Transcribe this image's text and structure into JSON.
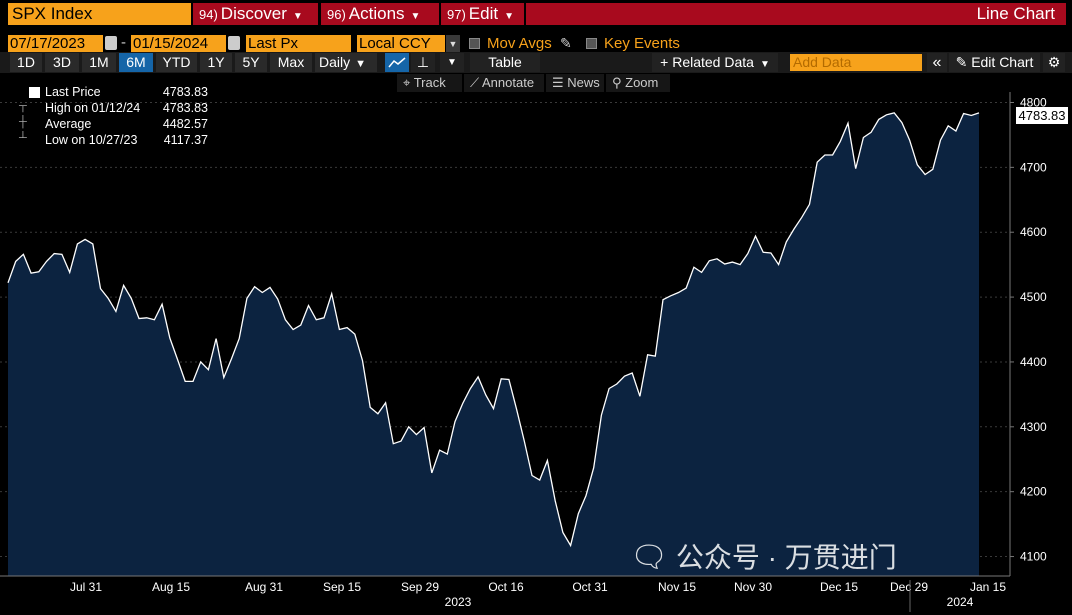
{
  "header": {
    "ticker": "SPX Index",
    "menus": [
      {
        "num": "94)",
        "label": "Discover"
      },
      {
        "num": "96)",
        "label": "Actions"
      },
      {
        "num": "97)",
        "label": "Edit"
      }
    ],
    "title": "Line Chart"
  },
  "controls": {
    "start_date": "07/17/2023",
    "end_date": "01/15/2024",
    "field": "Last Px",
    "currency": "Local CCY",
    "mov_avgs": "Mov Avgs",
    "key_events": "Key Events"
  },
  "toolbar": {
    "ranges": [
      "1D",
      "3D",
      "1M",
      "6M",
      "YTD",
      "1Y",
      "5Y",
      "Max"
    ],
    "selected_range": "6M",
    "frequency": "Daily",
    "table": "Table",
    "related_data": "+ Related Data",
    "add_data_placeholder": "Add Data",
    "edit_chart": "Edit Chart"
  },
  "subtoolbar": {
    "track": "Track",
    "annotate": "Annotate",
    "news": "News",
    "zoom": "Zoom"
  },
  "legend": {
    "rows": [
      {
        "label": "Last Price",
        "value": "4783.83"
      },
      {
        "label": "High on 01/12/24",
        "value": "4783.83"
      },
      {
        "label": "Average",
        "value": "4482.57"
      },
      {
        "label": "Low on 10/27/23",
        "value": "4117.37"
      }
    ]
  },
  "last_price_tag": "4783.83",
  "watermark": "公众号 · 万贯进门",
  "colors": {
    "area_fill": "#0c2340",
    "line": "#ffffff",
    "orange": "#f7a21b",
    "red": "#a80a1e"
  },
  "chart_data": {
    "type": "area",
    "title": "",
    "xlabel": "",
    "ylabel": "",
    "ylim": [
      4070,
      4810
    ],
    "y_ticks": [
      4100,
      4200,
      4300,
      4400,
      4500,
      4600,
      4700,
      4800
    ],
    "x_tick_labels": [
      "Jul 31",
      "Aug 15",
      "Aug 31",
      "Sep 15",
      "Sep 29",
      "Oct 16",
      "Oct 31",
      "Nov 15",
      "Nov 30",
      "Dec 15",
      "Dec 29",
      "Jan 15"
    ],
    "year_labels": [
      "2023",
      "2024"
    ],
    "grid": true,
    "series": [
      {
        "values": [
          4522,
          4555,
          4566,
          4537,
          4539,
          4555,
          4567,
          4566,
          4538,
          4582,
          4589,
          4582,
          4513,
          4498,
          4478,
          4518,
          4498,
          4467,
          4468,
          4465,
          4489,
          4437,
          4404,
          4370,
          4370,
          4400,
          4388,
          4436,
          4376,
          4405,
          4436,
          4498,
          4516,
          4507,
          4515,
          4497,
          4465,
          4450,
          4457,
          4487,
          4465,
          4468,
          4505,
          4450,
          4453,
          4443,
          4402,
          4330,
          4320,
          4337,
          4274,
          4278,
          4300,
          4288,
          4299,
          4229,
          4264,
          4258,
          4308,
          4336,
          4359,
          4377,
          4349,
          4328,
          4374,
          4373,
          4327,
          4278,
          4225,
          4218,
          4248,
          4186,
          4137,
          4117,
          4166,
          4194,
          4237,
          4318,
          4359,
          4366,
          4378,
          4383,
          4347,
          4411,
          4409,
          4496,
          4502,
          4507,
          4514,
          4546,
          4538,
          4556,
          4559,
          4551,
          4554,
          4550,
          4567,
          4594,
          4569,
          4568,
          4550,
          4585,
          4605,
          4623,
          4643,
          4708,
          4719,
          4719,
          4740,
          4768,
          4698,
          4746,
          4754,
          4774,
          4781,
          4784,
          4769,
          4742,
          4704,
          4689,
          4697,
          4742,
          4764,
          4756,
          4783,
          4780,
          4784
        ]
      }
    ]
  }
}
